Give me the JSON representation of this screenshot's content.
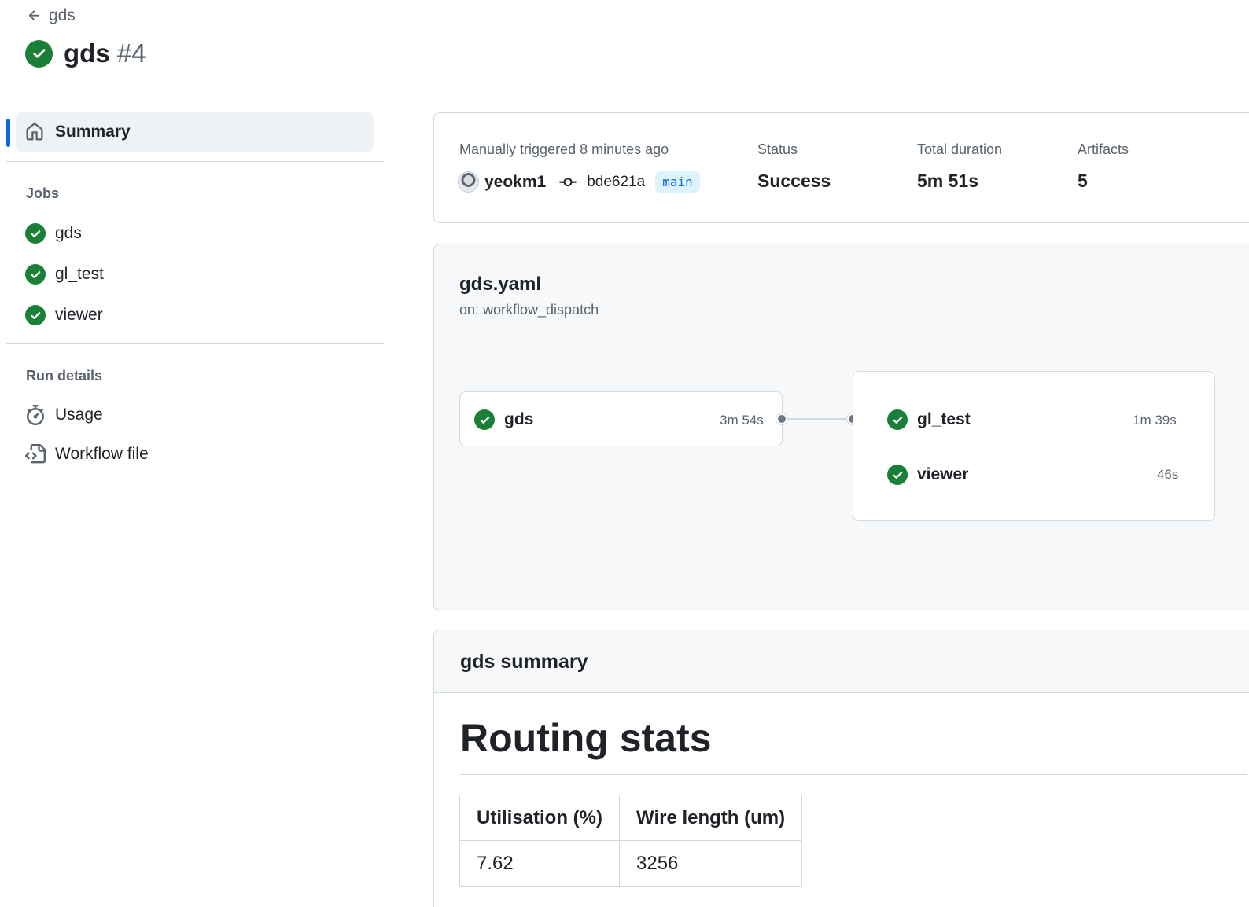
{
  "header": {
    "back_label": "gds",
    "title": "gds",
    "run_number": "#4"
  },
  "sidebar": {
    "summary_label": "Summary",
    "jobs_heading": "Jobs",
    "jobs": [
      {
        "label": "gds"
      },
      {
        "label": "gl_test"
      },
      {
        "label": "viewer"
      }
    ],
    "run_details_heading": "Run details",
    "usage_label": "Usage",
    "workflow_file_label": "Workflow file"
  },
  "run_summary": {
    "trigger_text": "Manually triggered 8 minutes ago",
    "actor": "yeokm1",
    "commit": "bde621a",
    "branch": "main",
    "status_label": "Status",
    "status_value": "Success",
    "duration_label": "Total duration",
    "duration_value": "5m 51s",
    "artifacts_label": "Artifacts",
    "artifacts_value": "5"
  },
  "workflow": {
    "file": "gds.yaml",
    "trigger": "on: workflow_dispatch",
    "jobs": [
      {
        "name": "gds",
        "duration": "3m 54s"
      },
      {
        "name": "gl_test",
        "duration": "1m 39s"
      },
      {
        "name": "viewer",
        "duration": "46s"
      }
    ]
  },
  "gds_summary": {
    "title": "gds summary",
    "heading": "Routing stats",
    "table": {
      "headers": [
        "Utilisation (%)",
        "Wire length (um)"
      ],
      "rows": [
        [
          "7.62",
          "3256"
        ]
      ]
    }
  },
  "colors": {
    "success": "#1a7f37",
    "accent": "#0969da",
    "muted": "#59636e"
  }
}
